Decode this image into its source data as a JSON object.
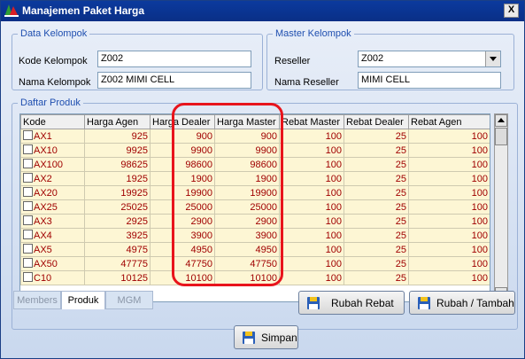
{
  "window": {
    "title": "Manajemen Paket Harga",
    "close_label": "X"
  },
  "data_kelompok": {
    "legend": "Data Kelompok",
    "kode_label": "Kode Kelompok",
    "kode_value": "Z002",
    "nama_label": "Nama Kelompok",
    "nama_value": "Z002 MIMI CELL"
  },
  "master_kelompok": {
    "legend": "Master Kelompok",
    "reseller_label": "Reseller",
    "reseller_value": "Z002",
    "nama_reseller_label": "Nama Reseller",
    "nama_reseller_value": "MIMI CELL"
  },
  "daftar_produk": {
    "legend": "Daftar Produk",
    "columns": [
      "Kode",
      "Harga Agen",
      "Harga Dealer",
      "Harga Master",
      "Rebat Master",
      "Rebat Dealer",
      "Rebat Agen"
    ],
    "rows": [
      [
        "AX1",
        "925",
        "900",
        "900",
        "100",
        "25",
        "100"
      ],
      [
        "AX10",
        "9925",
        "9900",
        "9900",
        "100",
        "25",
        "100"
      ],
      [
        "AX100",
        "98625",
        "98600",
        "98600",
        "100",
        "25",
        "100"
      ],
      [
        "AX2",
        "1925",
        "1900",
        "1900",
        "100",
        "25",
        "100"
      ],
      [
        "AX20",
        "19925",
        "19900",
        "19900",
        "100",
        "25",
        "100"
      ],
      [
        "AX25",
        "25025",
        "25000",
        "25000",
        "100",
        "25",
        "100"
      ],
      [
        "AX3",
        "2925",
        "2900",
        "2900",
        "100",
        "25",
        "100"
      ],
      [
        "AX4",
        "3925",
        "3900",
        "3900",
        "100",
        "25",
        "100"
      ],
      [
        "AX5",
        "4975",
        "4950",
        "4950",
        "100",
        "25",
        "100"
      ],
      [
        "AX50",
        "47775",
        "47750",
        "47750",
        "100",
        "25",
        "100"
      ],
      [
        "C10",
        "10125",
        "10100",
        "10100",
        "100",
        "25",
        "100"
      ]
    ]
  },
  "tabs": [
    {
      "label": "Members",
      "active": false
    },
    {
      "label": "Produk",
      "active": true
    },
    {
      "label": "MGM",
      "active": false
    }
  ],
  "buttons": {
    "rubah_rebat": "Rubah Rebat",
    "rubah_tambah": "Rubah / Tambah",
    "simpan": "Simpan"
  },
  "icons": {
    "app": "app-logo-icon",
    "button": "floppy-disk-icon"
  },
  "colors": {
    "titlebar": "#0b3a9e",
    "cell_text": "#a00000",
    "cell_bg": "#fdf6d4",
    "highlight": "#e8141c"
  }
}
